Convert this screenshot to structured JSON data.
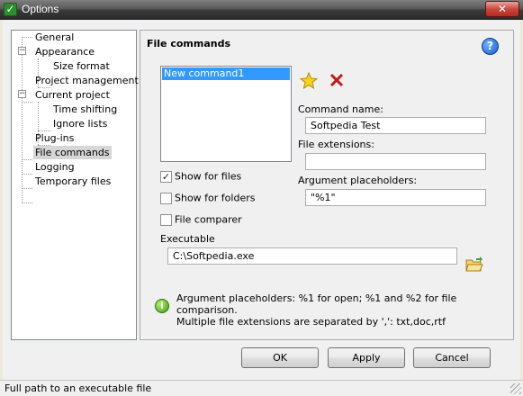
{
  "window": {
    "title": "Options",
    "icon": "check-icon",
    "close_glyph": "✕",
    "accent_color": "#3399ff"
  },
  "tree": {
    "items": [
      {
        "label": "General"
      },
      {
        "label": "Appearance",
        "expander": "−"
      },
      {
        "label": "Size format"
      },
      {
        "label": "Project management"
      },
      {
        "label": "Current project",
        "expander": "−"
      },
      {
        "label": "Time shifting"
      },
      {
        "label": "Ignore lists"
      },
      {
        "label": "Plug-ins"
      },
      {
        "label": "File commands",
        "selected": true
      },
      {
        "label": "Logging"
      },
      {
        "label": "Temporary files"
      }
    ]
  },
  "panel": {
    "title": "File commands",
    "help_glyph": "?",
    "commands_list": [
      "New command1"
    ],
    "add_icon": "star-add-icon",
    "delete_icon": "delete-x-icon",
    "command_name_label": "Command name:",
    "command_name_value": "Softpedia Test",
    "file_extensions_label": "File extensions:",
    "file_extensions_value": "",
    "argument_placeholders_label": "Argument placeholders:",
    "argument_placeholders_value": "\"%1\"",
    "show_for_files": {
      "label": "Show for files",
      "checked": true
    },
    "show_for_folders": {
      "label": "Show for folders",
      "checked": false
    },
    "file_comparer": {
      "label": "File comparer",
      "checked": false
    },
    "executable_label": "Executable",
    "executable_value": "C:\\Softpedia.exe",
    "browse_icon": "folder-open-icon",
    "info_glyph": "i",
    "info_line1": "Argument placeholders: %1 for open; %1 and %2 for file comparison.",
    "info_line2": "Multiple file extensions are separated by ',': txt,doc,rtf"
  },
  "buttons": {
    "ok": "OK",
    "apply": "Apply",
    "cancel": "Cancel"
  },
  "status": {
    "text": "Full path to an executable file"
  }
}
